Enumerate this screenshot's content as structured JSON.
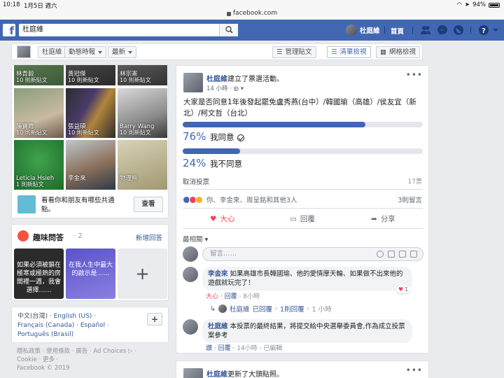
{
  "status": {
    "time": "10:18",
    "date": "1月5日 週六",
    "battery": "94%"
  },
  "url": "facebook.com",
  "header": {
    "search_value": "杜庭維",
    "user_name": "杜庭維",
    "home": "首頁"
  },
  "subbar": {
    "profile": "杜庭維",
    "activity": "動態時報",
    "sort": "最新",
    "manage": "管理貼文",
    "list_view": "清單檢視",
    "grid_view": "網格檢視"
  },
  "friends": [
    {
      "name": "林青毅",
      "count": "10 則新貼文"
    },
    {
      "name": "黃冠傑",
      "count": "10 則新貼文"
    },
    {
      "name": "林宗憲",
      "count": "10 則新貼文"
    },
    {
      "name": "陳寶霞",
      "count": "10 則新貼文"
    },
    {
      "name": "張益碩",
      "count": "10 則新貼文"
    },
    {
      "name": "Barry Wang",
      "count": "10 則新貼文"
    },
    {
      "name": "Leticia Hsieh",
      "count": "1 則新貼文"
    },
    {
      "name": "李金來",
      "count": ""
    },
    {
      "name": "物理熊",
      "count": ""
    }
  ],
  "suggest": {
    "text": "看看你和朋友有哪些共通點。",
    "button": "查看"
  },
  "qa": {
    "title": "趣味問答",
    "count": "· 2",
    "new_answer": "新增回答",
    "cards": [
      {
        "text": "如果必須被鎖在極寒或極熱的房間裡一週，我會選擇……"
      },
      {
        "text": "在我人生中最大的啟示是……"
      }
    ],
    "plus": "+"
  },
  "languages": {
    "current": "中文(台灣)",
    "others": [
      "English (US)",
      "Français (Canada)",
      "Español",
      "Português (Brasil)"
    ],
    "add": "+"
  },
  "footer": {
    "line1": "隱私政策 · 使用條款 · 廣告 · Ad Choices ▷ ·",
    "line2": "Cookie · 更多 ·",
    "line3": "Facebook © 2019"
  },
  "post": {
    "author": "杜庭維",
    "action": "建立了票選活動。",
    "time": "14 小時 · ",
    "text": "大家是否同意1年後發起罷免盧秀燕(台中）/韓國瑜（高雄）/侯友宜（新北）/柯文哲（台北）",
    "options": [
      {
        "pct": "76%",
        "value": 76,
        "label": "我同意"
      },
      {
        "pct": "24%",
        "value": 24,
        "label": "我不同意"
      }
    ],
    "cancel_vote": "取消投票",
    "votes": "17票",
    "reactions_text": "你、李金來、周呈銘和其他3人",
    "comments_count": "3則留言",
    "actions": {
      "love": "大心",
      "reply": "回覆",
      "share": "分享"
    },
    "sort": "最相關",
    "comment_placeholder": "留言……"
  },
  "comments": [
    {
      "author": "李金來",
      "text": "如果高雄市長韓國瑜、他的愛情摩天輪、如果做不出來他的遊戲就玩完了！",
      "love": "大心",
      "reply": "回覆",
      "time": "8小時",
      "badge": "1"
    },
    {
      "author": "杜庭維",
      "text": "本投票的最終結果，將提交給中央選舉委員會,作為成立投票案參考",
      "love": "讚",
      "reply": "回覆",
      "time": "14小時",
      "edited": "已編輯"
    }
  ],
  "reply_line": {
    "author": "杜庭維",
    "action": "已回覆",
    "count": "1則回覆",
    "time": "1 小時"
  },
  "post2": {
    "author": "杜庭維",
    "action": "更新了大頭貼照。"
  },
  "colors": {
    "brand": "#4267b2",
    "link": "#385898",
    "love": "#f33e58"
  }
}
